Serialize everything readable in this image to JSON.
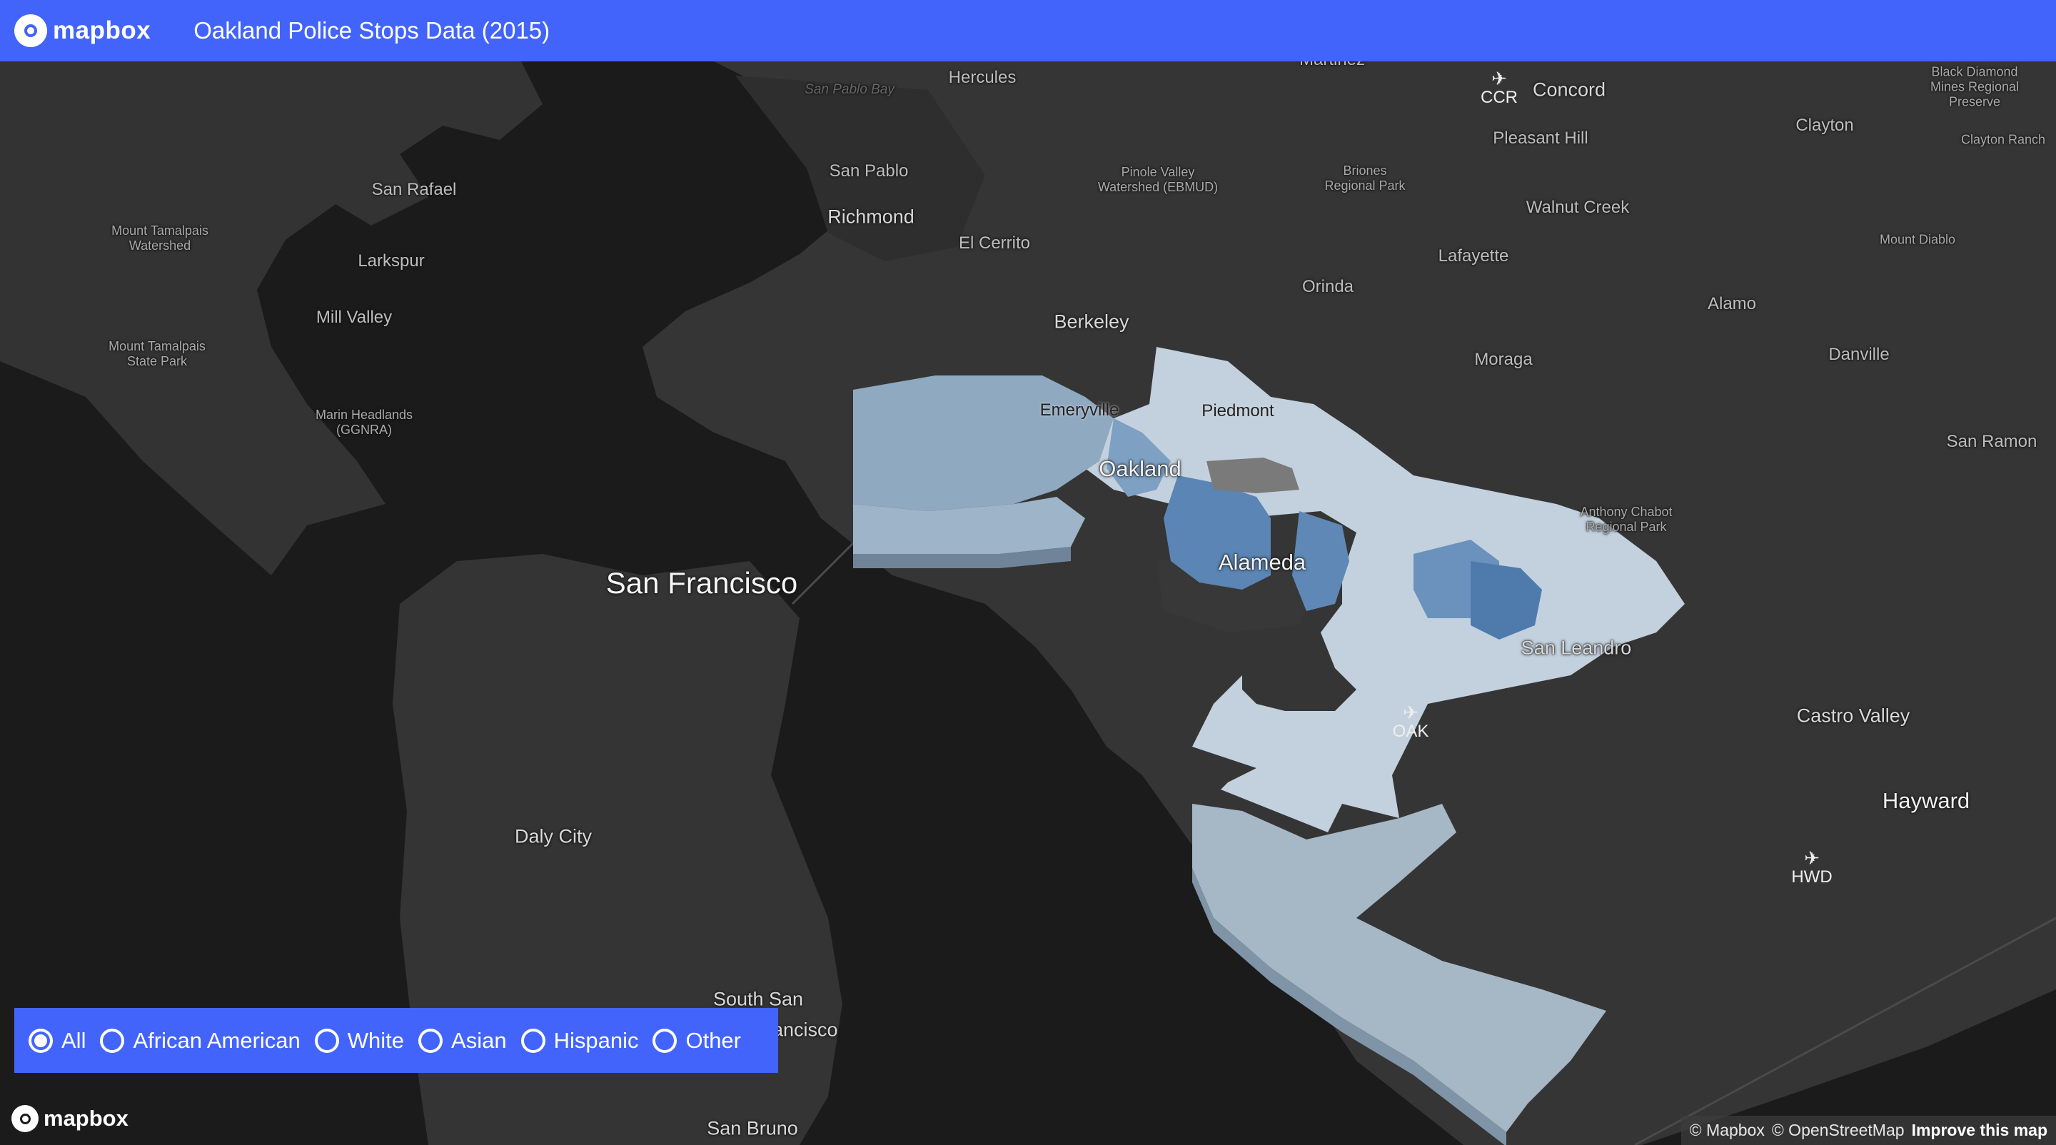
{
  "header": {
    "logo_text": "mapbox",
    "title": "Oakland Police Stops Data (2015)"
  },
  "map": {
    "colors": {
      "water": "#1b1b1b",
      "land": "#333333",
      "land_light": "#3a3a3a",
      "extrusion_light": "#c8d6e2",
      "extrusion_mid": "#9fb6cc",
      "extrusion_dark": "#5b86b3"
    },
    "places": {
      "martinez": "Martinez",
      "hercules": "Hercules",
      "san_pablo_bay": "San Pablo Bay",
      "concord": "Concord",
      "black_diamond_1": "Black Diamond",
      "black_diamond_2": "Mines Regional",
      "black_diamond_3": "Preserve",
      "clayton": "Clayton",
      "clayton_ranch": "Clayton Ranch",
      "pleasant_hill": "Pleasant Hill",
      "san_pablo": "San Pablo",
      "san_rafael": "San Rafael",
      "pinole_1": "Pinole Valley",
      "pinole_2": "Watershed (EBMUD)",
      "briones_1": "Briones",
      "briones_2": "Regional Park",
      "richmond": "Richmond",
      "walnut_creek": "Walnut Creek",
      "tamalpais_watershed_1": "Mount Tamalpais",
      "tamalpais_watershed_2": "Watershed",
      "el_cerrito": "El Cerrito",
      "mount_diablo": "Mount Diablo",
      "larkspur": "Larkspur",
      "lafayette": "Lafayette",
      "orinda": "Orinda",
      "alamo": "Alamo",
      "mill_valley": "Mill Valley",
      "berkeley": "Berkeley",
      "tamalpais_sp_1": "Mount Tamalpais",
      "tamalpais_sp_2": "State Park",
      "danville": "Danville",
      "moraga": "Moraga",
      "emeryville": "Emeryville",
      "piedmont": "Piedmont",
      "marin_headlands_1": "Marin Headlands",
      "marin_headlands_2": "(GGNRA)",
      "san_ramon": "San Ramon",
      "oakland": "Oakland",
      "chabot_1": "Anthony Chabot",
      "chabot_2": "Regional Park",
      "san_francisco": "San Francisco",
      "alameda": "Alameda",
      "san_leandro": "San Leandro",
      "castro_valley": "Castro Valley",
      "hayward": "Hayward",
      "daly_city": "Daly City",
      "south_sf_1": "South San",
      "south_sf_2": "Francisco",
      "san_bruno": "San Bruno"
    },
    "airports": {
      "ccr": "CCR",
      "oak": "OAK",
      "hwd": "HWD",
      "plane_glyph": "✈"
    }
  },
  "filter": {
    "selected": "All",
    "options": [
      {
        "label": "All",
        "selected": true
      },
      {
        "label": "African American",
        "selected": false
      },
      {
        "label": "White",
        "selected": false
      },
      {
        "label": "Asian",
        "selected": false
      },
      {
        "label": "Hispanic",
        "selected": false
      },
      {
        "label": "Other",
        "selected": false
      }
    ]
  },
  "footer": {
    "logo_text": "mapbox",
    "attribution_mapbox": "© Mapbox",
    "attribution_osm": "© OpenStreetMap",
    "improve_link": "Improve this map"
  }
}
